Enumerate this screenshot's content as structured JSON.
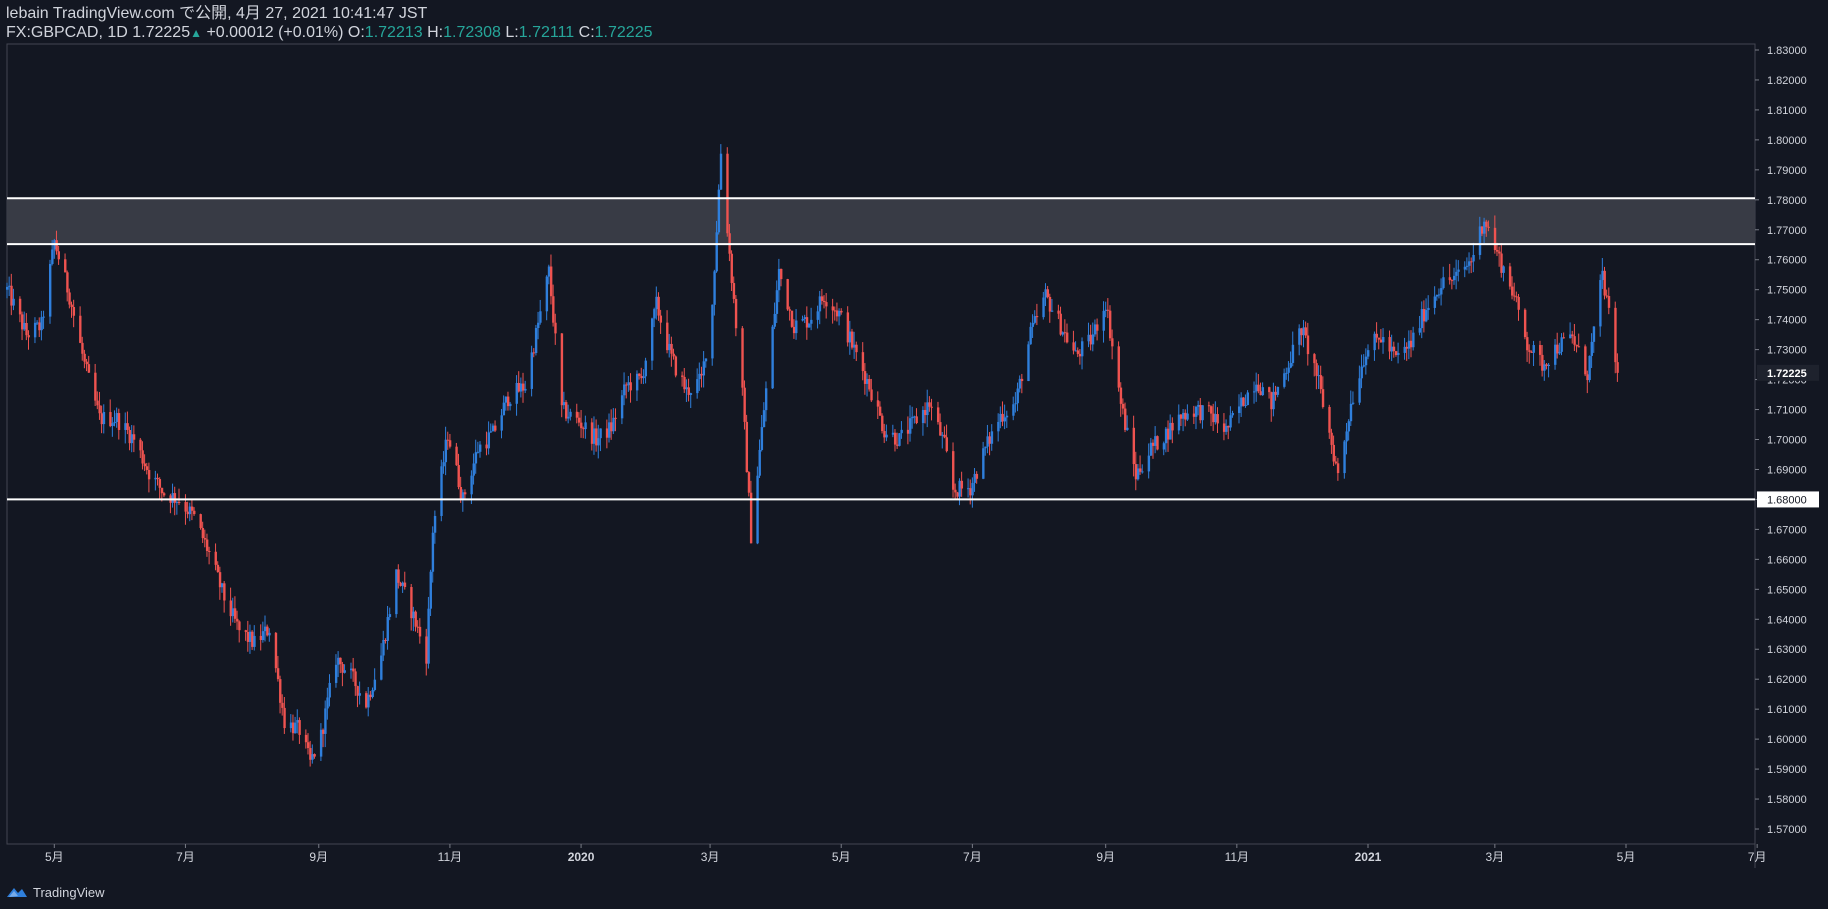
{
  "header": {
    "line1": "lebain TradingView.com で公開, 4月 27, 2021 10:41:47 JST",
    "symbol": "FX:GBPCAD, 1D",
    "last": "1.72225",
    "change": "+0.00012 (+0.01%)",
    "o_label": "O:",
    "o_value": "1.72213",
    "h_label": "H:",
    "h_value": "1.72308",
    "l_label": "L:",
    "l_value": "1.72111",
    "c_label": "C:",
    "c_value": "1.72225"
  },
  "footer": {
    "brand": "TradingView",
    "logo_icon": "tradingview-logo-icon"
  },
  "colors": {
    "background": "#131722",
    "up": "#2f7fdc",
    "down": "#ef5350",
    "axis_text": "#d1d4dc",
    "zone": "#3a3d48",
    "level_line": "#ffffff"
  },
  "chart_data": {
    "type": "candlestick",
    "symbol": "FX:GBPCAD",
    "timeframe": "1D",
    "x_range": [
      "2019-04-09",
      "2021-06-30"
    ],
    "ylim": [
      1.565,
      1.832
    ],
    "y_ticks": [
      "1.83000",
      "1.82000",
      "1.81000",
      "1.80000",
      "1.79000",
      "1.78000",
      "1.77000",
      "1.76000",
      "1.75000",
      "1.74000",
      "1.73000",
      "1.72000",
      "1.71000",
      "1.70000",
      "1.69000",
      "1.68000",
      "1.67000",
      "1.66000",
      "1.65000",
      "1.64000",
      "1.63000",
      "1.62000",
      "1.61000",
      "1.60000",
      "1.59000",
      "1.58000",
      "1.57000"
    ],
    "x_ticks": [
      {
        "label": "5月",
        "date": "2019-05-01"
      },
      {
        "label": "7月",
        "date": "2019-07-01"
      },
      {
        "label": "9月",
        "date": "2019-09-01"
      },
      {
        "label": "11月",
        "date": "2019-11-01"
      },
      {
        "label": "2020",
        "date": "2020-01-01"
      },
      {
        "label": "3月",
        "date": "2020-03-01"
      },
      {
        "label": "5月",
        "date": "2020-05-01"
      },
      {
        "label": "7月",
        "date": "2020-07-01"
      },
      {
        "label": "9月",
        "date": "2020-09-01"
      },
      {
        "label": "11月",
        "date": "2020-11-01"
      },
      {
        "label": "2021",
        "date": "2021-01-01"
      },
      {
        "label": "3月",
        "date": "2021-03-01"
      },
      {
        "label": "5月",
        "date": "2021-05-01"
      },
      {
        "label": "7月",
        "date": "2021-07-01"
      }
    ],
    "last_price_label": "1.72225",
    "last_price": 1.72225,
    "zone": {
      "low": 1.7652,
      "high": 1.7805
    },
    "support_level": 1.68,
    "support_label": "1.68000",
    "close_path": [
      [
        "2019-04-09",
        1.75
      ],
      [
        "2019-04-18",
        1.735
      ],
      [
        "2019-04-25",
        1.738
      ],
      [
        "2019-05-01",
        1.766
      ],
      [
        "2019-05-08",
        1.748
      ],
      [
        "2019-05-15",
        1.725
      ],
      [
        "2019-05-22",
        1.707
      ],
      [
        "2019-05-30",
        1.707
      ],
      [
        "2019-06-07",
        1.7
      ],
      [
        "2019-06-14",
        1.689
      ],
      [
        "2019-06-21",
        1.682
      ],
      [
        "2019-06-28",
        1.68
      ],
      [
        "2019-07-05",
        1.674
      ],
      [
        "2019-07-12",
        1.662
      ],
      [
        "2019-07-19",
        1.647
      ],
      [
        "2019-07-26",
        1.636
      ],
      [
        "2019-08-02",
        1.632
      ],
      [
        "2019-08-09",
        1.637
      ],
      [
        "2019-08-16",
        1.606
      ],
      [
        "2019-08-23",
        1.603
      ],
      [
        "2019-08-28",
        1.592
      ],
      [
        "2019-09-02",
        1.601
      ],
      [
        "2019-09-09",
        1.627
      ],
      [
        "2019-09-16",
        1.621
      ],
      [
        "2019-09-23",
        1.612
      ],
      [
        "2019-09-30",
        1.628
      ],
      [
        "2019-10-07",
        1.655
      ],
      [
        "2019-10-14",
        1.643
      ],
      [
        "2019-10-21",
        1.628
      ],
      [
        "2019-10-24",
        1.67
      ],
      [
        "2019-10-31",
        1.702
      ],
      [
        "2019-11-07",
        1.68
      ],
      [
        "2019-11-14",
        1.697
      ],
      [
        "2019-11-21",
        1.702
      ],
      [
        "2019-11-28",
        1.714
      ],
      [
        "2019-12-06",
        1.718
      ],
      [
        "2019-12-13",
        1.742
      ],
      [
        "2019-12-17",
        1.756
      ],
      [
        "2019-12-23",
        1.71
      ],
      [
        "2019-12-31",
        1.706
      ],
      [
        "2020-01-08",
        1.7
      ],
      [
        "2020-01-15",
        1.704
      ],
      [
        "2020-01-22",
        1.718
      ],
      [
        "2020-01-29",
        1.72
      ],
      [
        "2020-02-05",
        1.745
      ],
      [
        "2020-02-12",
        1.727
      ],
      [
        "2020-02-19",
        1.716
      ],
      [
        "2020-02-26",
        1.72
      ],
      [
        "2020-03-02",
        1.745
      ],
      [
        "2020-03-06",
        1.796
      ],
      [
        "2020-03-10",
        1.762
      ],
      [
        "2020-03-16",
        1.715
      ],
      [
        "2020-03-20",
        1.668
      ],
      [
        "2020-03-26",
        1.71
      ],
      [
        "2020-04-02",
        1.756
      ],
      [
        "2020-04-09",
        1.738
      ],
      [
        "2020-04-16",
        1.74
      ],
      [
        "2020-04-23",
        1.748
      ],
      [
        "2020-04-30",
        1.742
      ],
      [
        "2020-05-07",
        1.73
      ],
      [
        "2020-05-14",
        1.718
      ],
      [
        "2020-05-21",
        1.703
      ],
      [
        "2020-05-28",
        1.7
      ],
      [
        "2020-06-04",
        1.706
      ],
      [
        "2020-06-11",
        1.712
      ],
      [
        "2020-06-18",
        1.698
      ],
      [
        "2020-06-22",
        1.683
      ],
      [
        "2020-06-30",
        1.684
      ],
      [
        "2020-07-07",
        1.697
      ],
      [
        "2020-07-14",
        1.708
      ],
      [
        "2020-07-21",
        1.712
      ],
      [
        "2020-07-28",
        1.735
      ],
      [
        "2020-08-04",
        1.748
      ],
      [
        "2020-08-11",
        1.738
      ],
      [
        "2020-08-18",
        1.728
      ],
      [
        "2020-08-25",
        1.733
      ],
      [
        "2020-09-01",
        1.746
      ],
      [
        "2020-09-08",
        1.712
      ],
      [
        "2020-09-15",
        1.688
      ],
      [
        "2020-09-22",
        1.697
      ],
      [
        "2020-09-29",
        1.702
      ],
      [
        "2020-10-06",
        1.708
      ],
      [
        "2020-10-13",
        1.71
      ],
      [
        "2020-10-20",
        1.708
      ],
      [
        "2020-10-27",
        1.703
      ],
      [
        "2020-11-03",
        1.712
      ],
      [
        "2020-11-10",
        1.72
      ],
      [
        "2020-11-17",
        1.712
      ],
      [
        "2020-11-24",
        1.724
      ],
      [
        "2020-12-01",
        1.737
      ],
      [
        "2020-12-08",
        1.722
      ],
      [
        "2020-12-14",
        1.702
      ],
      [
        "2020-12-18",
        1.688
      ],
      [
        "2020-12-24",
        1.712
      ],
      [
        "2020-12-31",
        1.73
      ],
      [
        "2021-01-07",
        1.734
      ],
      [
        "2021-01-14",
        1.727
      ],
      [
        "2021-01-21",
        1.732
      ],
      [
        "2021-01-28",
        1.744
      ],
      [
        "2021-02-04",
        1.752
      ],
      [
        "2021-02-11",
        1.754
      ],
      [
        "2021-02-18",
        1.76
      ],
      [
        "2021-02-24",
        1.774
      ],
      [
        "2021-03-02",
        1.762
      ],
      [
        "2021-03-09",
        1.75
      ],
      [
        "2021-03-16",
        1.732
      ],
      [
        "2021-03-23",
        1.725
      ],
      [
        "2021-03-30",
        1.731
      ],
      [
        "2021-04-06",
        1.734
      ],
      [
        "2021-04-13",
        1.722
      ],
      [
        "2021-04-20",
        1.755
      ],
      [
        "2021-04-27",
        1.72225
      ]
    ],
    "grid": false,
    "legend": "none"
  }
}
